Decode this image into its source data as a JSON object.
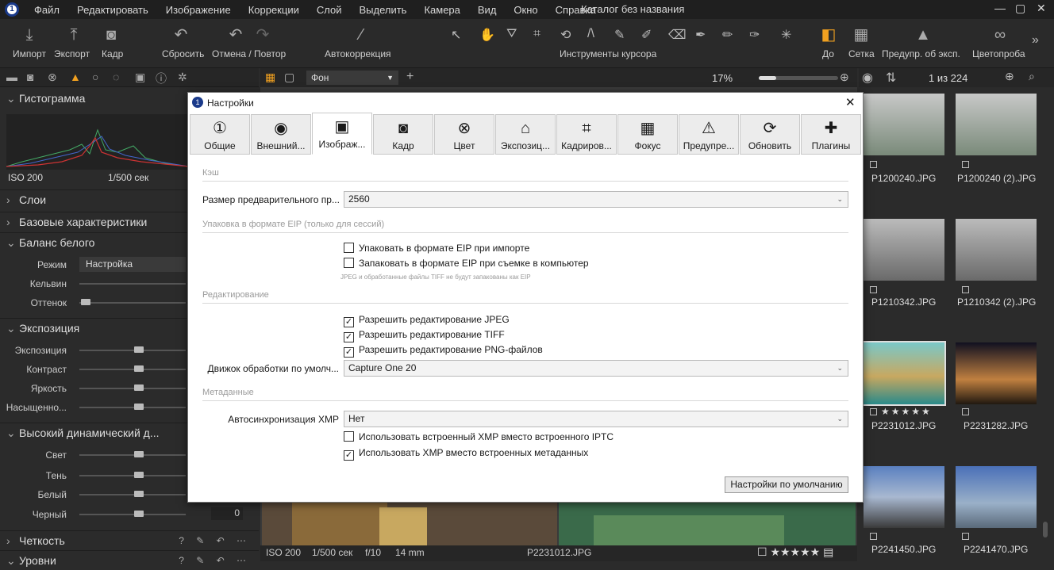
{
  "menu": {
    "items": [
      "Файл",
      "Редактировать",
      "Изображение",
      "Коррекции",
      "Слой",
      "Выделить",
      "Камера",
      "Вид",
      "Окно",
      "Справка"
    ],
    "title": "Каталог без названия",
    "logo": "1"
  },
  "toolbar": {
    "import": "Импорт",
    "export": "Экспорт",
    "capture": "Кадр",
    "reset": "Сбросить",
    "undo_redo": "Отмена / Повтор",
    "autocorrect": "Автокоррекция",
    "cursor_tools": "Инструменты курсора",
    "before": "До",
    "grid": "Сетка",
    "exposure_warning": "Предупр. об эксп.",
    "color_proof": "Цветопроба"
  },
  "center_bar": {
    "background_select": "Фон",
    "zoom": "17%"
  },
  "right_bar": {
    "count": "1 из 224"
  },
  "left": {
    "histogram": "Гистограмма",
    "iso": "ISO 200",
    "shutter": "1/500 сек",
    "layers": "Слои",
    "base": "Базовые характеристики",
    "wb": "Баланс белого",
    "wb_mode_label": "Режим",
    "wb_mode": "Настройка",
    "kelvin": "Кельвин",
    "tint": "Оттенок",
    "exposure_section": "Экспозиция",
    "exposure": "Экспозиция",
    "contrast": "Контраст",
    "brightness": "Яркость",
    "saturation": "Насыщенно...",
    "hdr": "Высокий динамический д...",
    "light": "Свет",
    "shadow": "Тень",
    "white": "Белый",
    "black": "Черный",
    "black_value": "0",
    "sharpness": "Четкость",
    "levels": "Уровни"
  },
  "viewer_info": {
    "iso": "ISO 200",
    "shutter": "1/500 сек",
    "aperture": "f/10",
    "focal": "14 mm",
    "file": "P2231012.JPG"
  },
  "thumbs": [
    {
      "name": "P1200240.JPG"
    },
    {
      "name": "P1200240 (2).JPG"
    },
    {
      "name": "P1210342.JPG"
    },
    {
      "name": "P1210342 (2).JPG"
    },
    {
      "name": "P2231012.JPG",
      "stars": "★★★★★"
    },
    {
      "name": "P2231282.JPG"
    },
    {
      "name": "P2241450.JPG"
    },
    {
      "name": "P2241470.JPG"
    }
  ],
  "dialog": {
    "title": "Настройки",
    "tabs": [
      "Общие",
      "Внешний...",
      "Изображ...",
      "Кадр",
      "Цвет",
      "Экспозиц...",
      "Кадриров...",
      "Фокус",
      "Предупре...",
      "Обновить",
      "Плагины"
    ],
    "cache": "Кэш",
    "preview_label": "Размер предварительного пр...",
    "preview_value": "2560",
    "eip_group": "Упаковка в формате EIP (только для сессий)",
    "eip_import": "Упаковать в формате EIP при импорте",
    "eip_capture": "Запаковать в формате EIP при съемке в компьютер",
    "eip_note": "JPEG и обработанные файлы TIFF не будут запакованы как EIP",
    "edit_group": "Редактирование",
    "edit_jpeg": "Разрешить редактирование JPEG",
    "edit_tiff": "Разрешить редактирование TIFF",
    "edit_png": "Разрешить редактирование PNG-файлов",
    "engine_label": "Движок обработки по умолч...",
    "engine_value": "Capture One 20",
    "meta_group": "Метаданные",
    "xmp_label": "Автосинхронизация XMP",
    "xmp_value": "Нет",
    "xmp_embedded": "Использовать встроенный XMP вместо встроенного IPTC",
    "xmp_over": "Использовать XMP вместо встроенных метаданных",
    "defaults_button": "Настройки по умолчанию"
  }
}
